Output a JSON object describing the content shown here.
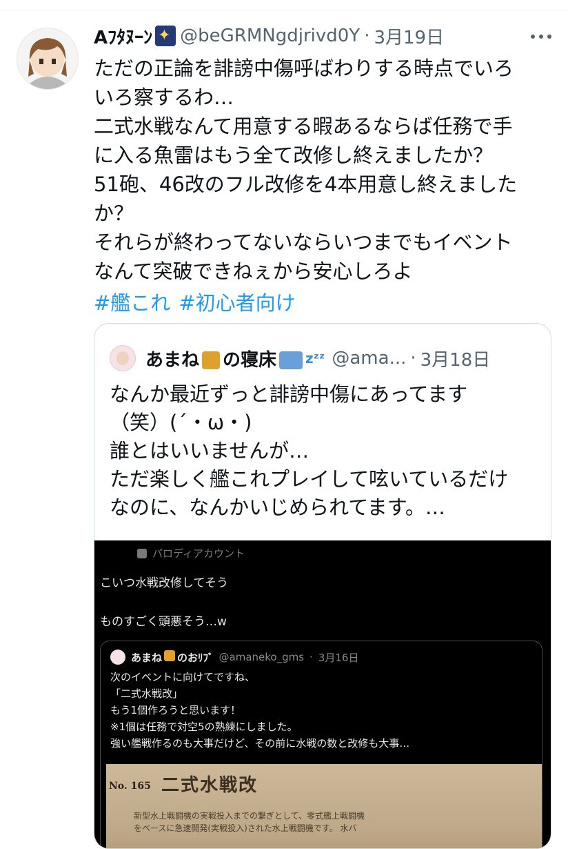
{
  "tweet": {
    "user_name": "Aﾌﾀﾇｰﾝ",
    "handle": "@beGRMNgdjrivd0Y",
    "date": "3月19日",
    "body": "ただの正論を誹謗中傷呼ばわりする時点でいろ\nいろ察するわ…\n二式水戦なんて用意する暇あるならば任務で手\nに入る魚雷はもう全て改修し終えましたか？\n51砲、46改のフル改修を4本用意し終えました\nか？\nそれらが終わってないならいつまでもイベント\nなんて突破できねぇから安心しろよ",
    "hashtags": [
      "#艦これ",
      "#初心者向け"
    ],
    "avatar_icon": "anime-avatar",
    "badge_icon": "stars-emoji-icon",
    "more_icon": "more-icon"
  },
  "quote": {
    "user_name_a": "あまね",
    "user_name_b": "の寝床",
    "zzz": "zᶻᶻ",
    "handle": "@ama...",
    "date": "3月18日",
    "body": "なんか最近ずっと誹謗中傷にあってます\n（笑）(´・ω・)\n誰とはいいませんが…\nただ楽しく艦これプレイして呟いているだけ\nなのに、なんかいじめられてます。…"
  },
  "screenshot": {
    "parody_label": "パロディアカウント",
    "text": "こいつ水戦改修してそう\n\nものすごく頭悪そう…w",
    "inner": {
      "user_name_a": "あまね",
      "user_name_b": "のおﾘﾌﾞ",
      "handle": "@amaneko_gms",
      "date": "3月16日",
      "body": "次のイベントに向けてですね、\n「二式水戦改」\nもう1個作ろうと思います！\n※1個は任務で対空5の熟練にしました。\n強い艦戦作るのも大事だけど、その前に水戦の数と改修も大事…"
    },
    "card": {
      "number": "No. 165",
      "title": "二式水戦改",
      "text": "新型水上戦闘機の実戦投入までの繋ぎとして、零式艦上戦闘機\nをベースに急速開発(実戦投入)された水上戦闘機です。 水バ"
    }
  }
}
